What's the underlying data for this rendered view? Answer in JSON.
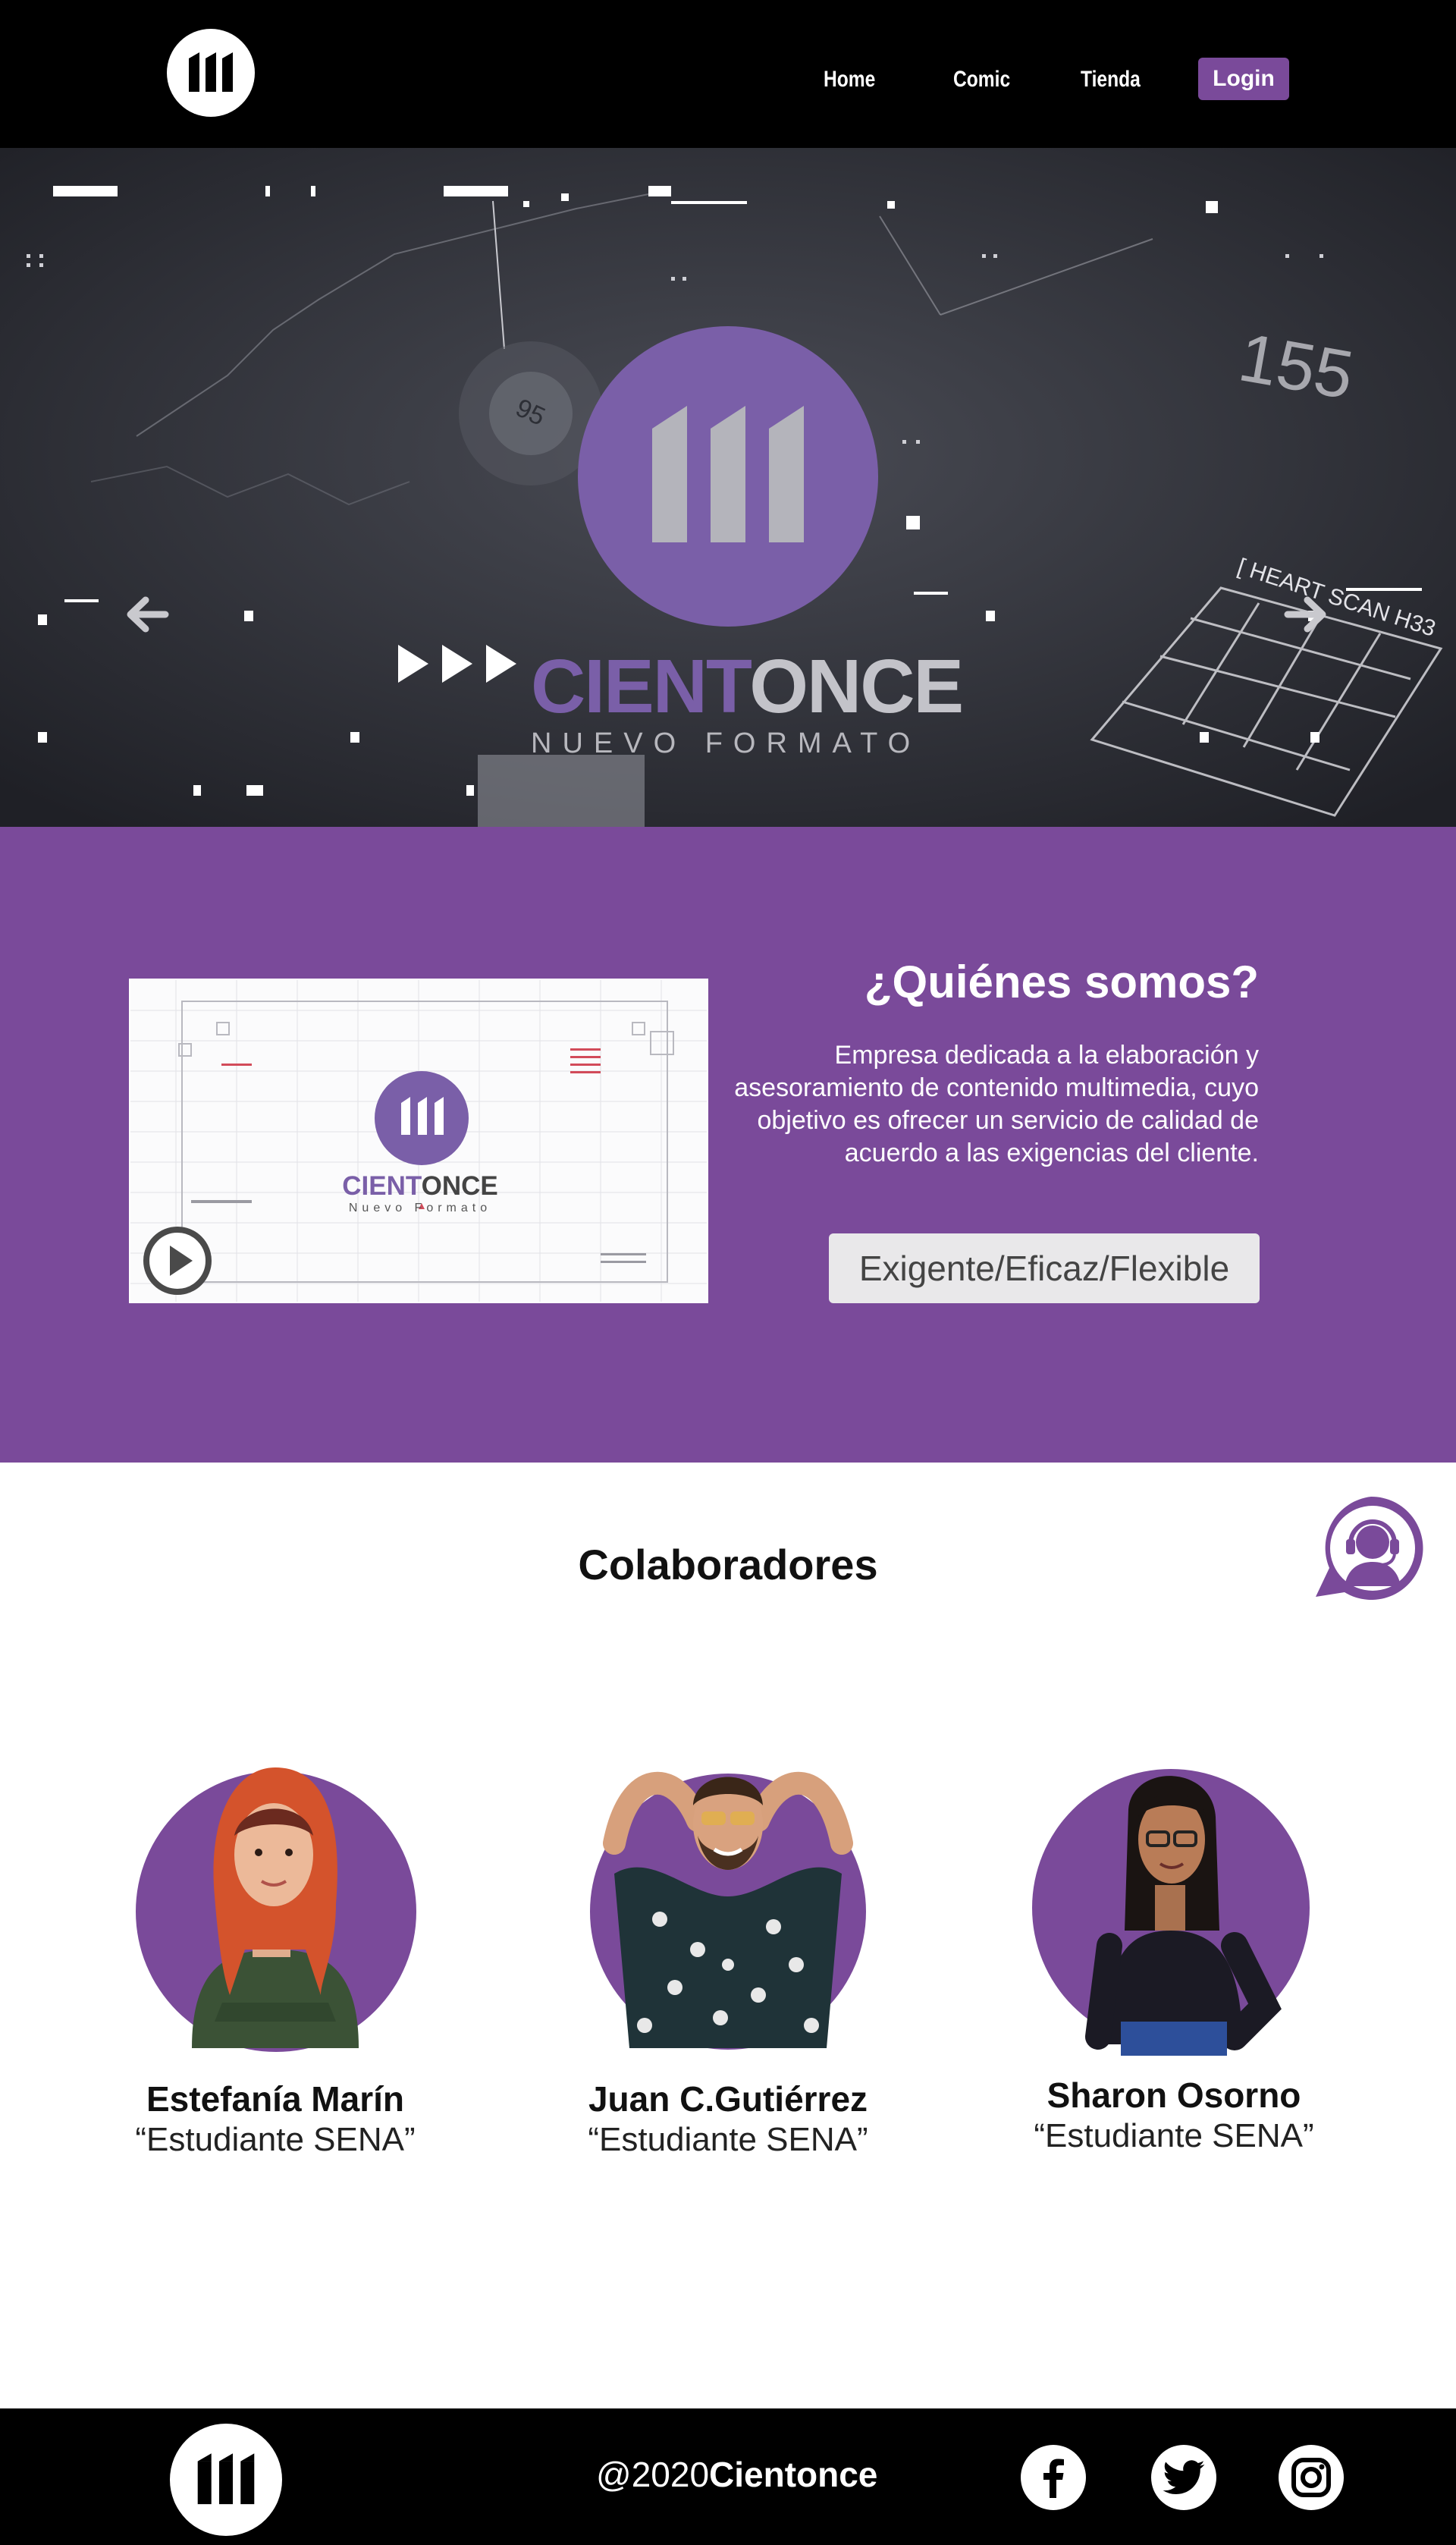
{
  "header": {
    "nav": [
      "Home",
      "Comic",
      "Tienda"
    ],
    "login_label": "Login"
  },
  "hero": {
    "brand_part1": "CIENT",
    "brand_part2": "ONCE",
    "tagline": "NUEVO FORMATO",
    "bg_numbers": [
      "155",
      "95"
    ],
    "bg_label": "[ HEART SCAN H33"
  },
  "about": {
    "title": "¿Quiénes somos?",
    "text": "Empresa dedicada a la elaboración y asesoramiento de contenido multimedia, cuyo objetivo es ofrecer un servicio de calidad de acuerdo a las exigencias del cliente.",
    "values": "Exigente/Eficaz/Flexible",
    "video": {
      "brand_part1": "CIENT",
      "brand_part2": "ONCE",
      "tagline": "Nuevo Formato"
    }
  },
  "collaborators": {
    "title": "Colaboradores",
    "people": [
      {
        "name": "Estefanía Marín",
        "role": "“Estudiante SENA”"
      },
      {
        "name": "Juan C.Gutiérrez",
        "role": "“Estudiante SENA”"
      },
      {
        "name": "Sharon Osorno",
        "role": "“Estudiante SENA”"
      }
    ]
  },
  "footer": {
    "copyright_prefix": "@2020",
    "copyright_brand": "Cientonce"
  },
  "colors": {
    "brand_purple": "#7a4a9a",
    "header_bg": "#000000"
  },
  "icons": [
    "logo-icon",
    "arrow-left-icon",
    "arrow-right-icon",
    "play-icon",
    "support-headset-icon",
    "facebook-icon",
    "twitter-icon",
    "instagram-icon"
  ]
}
